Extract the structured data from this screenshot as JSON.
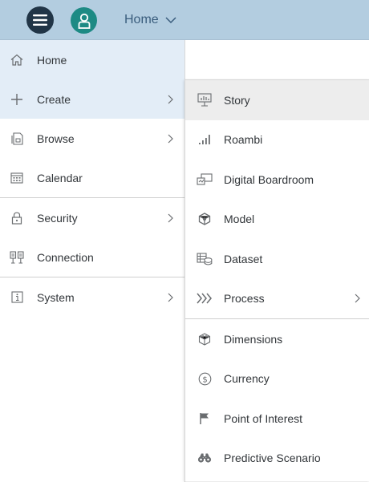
{
  "topbar": {
    "home_label": "Home",
    "colors": {
      "bar": "#b3cde0",
      "menu_button": "#213547",
      "avatar": "#1d8a84",
      "home_text": "#3a5d7d"
    }
  },
  "left_menu": {
    "items": [
      {
        "label": "Home",
        "icon": "home-icon",
        "active": true
      },
      {
        "label": "Create",
        "icon": "plus-icon",
        "active": true,
        "has_submenu": true
      },
      {
        "label": "Browse",
        "icon": "browse-icon",
        "has_submenu": true
      },
      {
        "label": "Calendar",
        "icon": "calendar-icon"
      },
      {
        "label": "Security",
        "icon": "lock-icon",
        "has_submenu": true
      },
      {
        "label": "Connection",
        "icon": "connection-icon"
      },
      {
        "label": "System",
        "icon": "info-icon",
        "has_submenu": true
      }
    ]
  },
  "create_submenu": {
    "items": [
      {
        "label": "Story",
        "icon": "story-icon",
        "hover": true
      },
      {
        "label": "Roambi",
        "icon": "signal-bars-icon"
      },
      {
        "label": "Digital Boardroom",
        "icon": "boardroom-icon"
      },
      {
        "label": "Model",
        "icon": "cube-icon"
      },
      {
        "label": "Dataset",
        "icon": "dataset-icon"
      },
      {
        "label": "Process",
        "icon": "process-chevrons-icon",
        "has_submenu": true
      },
      {
        "label": "Dimensions",
        "icon": "dimensions-icon"
      },
      {
        "label": "Currency",
        "icon": "currency-icon"
      },
      {
        "label": "Point of Interest",
        "icon": "flag-icon"
      },
      {
        "label": "Predictive Scenario",
        "icon": "binoculars-icon"
      }
    ]
  }
}
